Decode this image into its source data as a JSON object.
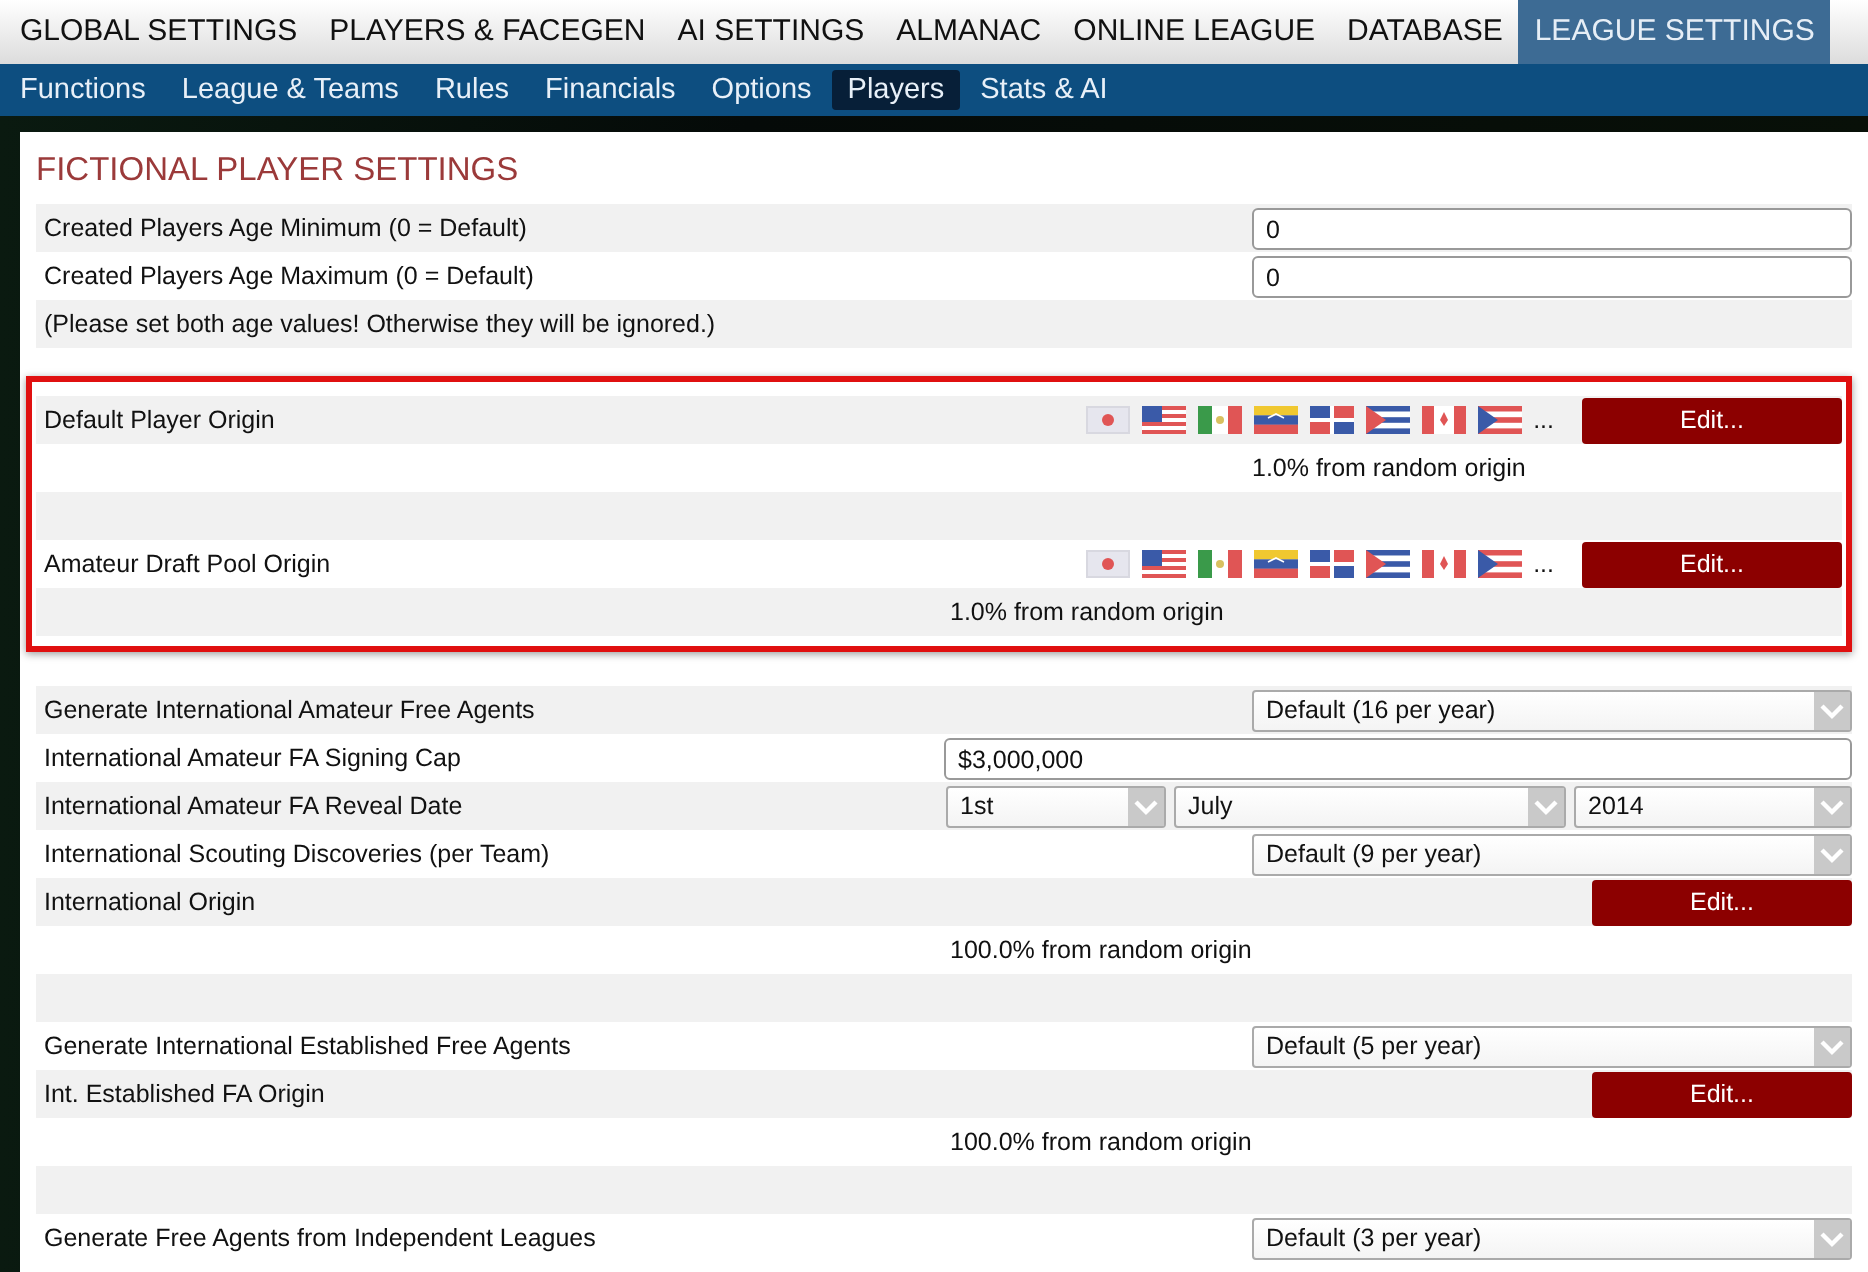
{
  "top_tabs": [
    {
      "label": "GLOBAL SETTINGS",
      "selected": false
    },
    {
      "label": "PLAYERS & FACEGEN",
      "selected": false
    },
    {
      "label": "AI SETTINGS",
      "selected": false
    },
    {
      "label": "ALMANAC",
      "selected": false
    },
    {
      "label": "ONLINE LEAGUE",
      "selected": false
    },
    {
      "label": "DATABASE",
      "selected": false
    },
    {
      "label": "LEAGUE SETTINGS",
      "selected": true
    }
  ],
  "sub_tabs": [
    {
      "label": "Functions",
      "selected": false
    },
    {
      "label": "League & Teams",
      "selected": false
    },
    {
      "label": "Rules",
      "selected": false
    },
    {
      "label": "Financials",
      "selected": false
    },
    {
      "label": "Options",
      "selected": false
    },
    {
      "label": "Players",
      "selected": true
    },
    {
      "label": "Stats & AI",
      "selected": false
    }
  ],
  "section_title": "FICTIONAL PLAYER SETTINGS",
  "age_rows": [
    {
      "kind": "input",
      "label": "Created Players Age Minimum (0 = Default)",
      "value": "0"
    },
    {
      "kind": "input",
      "label": "Created Players Age Maximum (0 = Default)",
      "value": "0"
    },
    {
      "kind": "note",
      "label": "(Please set both age values! Otherwise they will be ignored.)"
    }
  ],
  "highlighted_rows": [
    {
      "kind": "origin",
      "label": "Default Player Origin",
      "flags": true,
      "more": "...",
      "button": "Edit...",
      "summary": "1.0% from random origin"
    },
    {
      "kind": "origin",
      "label": "Amateur Draft Pool Origin",
      "flags": true,
      "more": "...",
      "button": "Edit...",
      "summary": "1.0% from random origin"
    }
  ],
  "rows": [
    {
      "kind": "select",
      "label": "Generate International Amateur Free Agents",
      "value": "Default (16 per year)"
    },
    {
      "kind": "wide_input",
      "label": "International Amateur FA Signing Cap",
      "value": "$3,000,000"
    },
    {
      "kind": "date",
      "label": "International Amateur FA Reveal Date",
      "values": [
        "1st",
        "July",
        "2014"
      ]
    },
    {
      "kind": "select",
      "label": "International Scouting Discoveries (per Team)",
      "value": "Default (9 per year)"
    },
    {
      "kind": "origin",
      "label": "International Origin",
      "flags": false,
      "button": "Edit...",
      "summary": "100.0% from random origin"
    },
    {
      "kind": "select",
      "label": "Generate International Established Free Agents",
      "value": "Default (5 per year)"
    },
    {
      "kind": "origin",
      "label": "Int. Established FA Origin",
      "flags": false,
      "button": "Edit...",
      "summary": "100.0% from random origin"
    },
    {
      "kind": "select",
      "label": "Generate Free Agents from Independent Leagues",
      "value": "Default (3 per year)"
    }
  ]
}
